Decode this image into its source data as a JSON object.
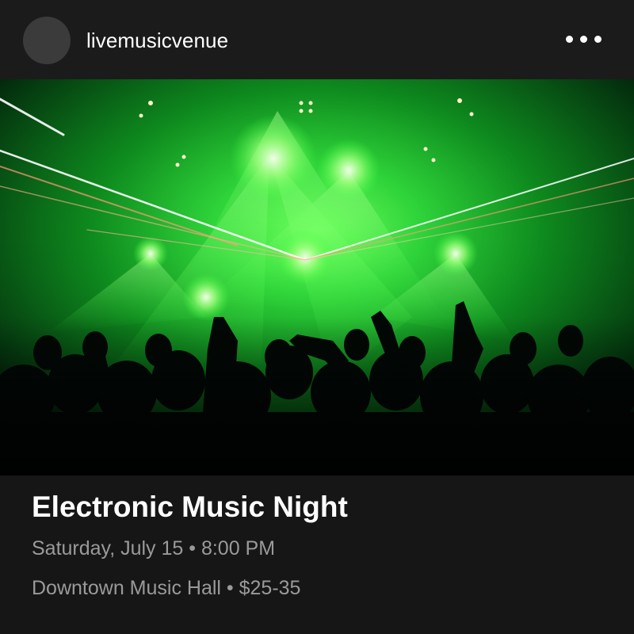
{
  "account": {
    "username": "livemusicvenue",
    "avatar_icon": "avatar-placeholder",
    "more_icon": "more-horizontal-icon"
  },
  "photo": {
    "subject": "concert crowd with green lasers"
  },
  "event": {
    "title": "Electronic Music Night",
    "datetime": "Saturday, July 15 • 8:00 PM",
    "location_price": "Downtown Music Hall • $25-35"
  },
  "colors": {
    "background": "#161616",
    "header": "#1b1b1b",
    "avatar": "#3b3b3b",
    "text_primary": "#ffffff",
    "text_secondary": "#9a9a9a",
    "laser_green": "#39ff4a"
  }
}
